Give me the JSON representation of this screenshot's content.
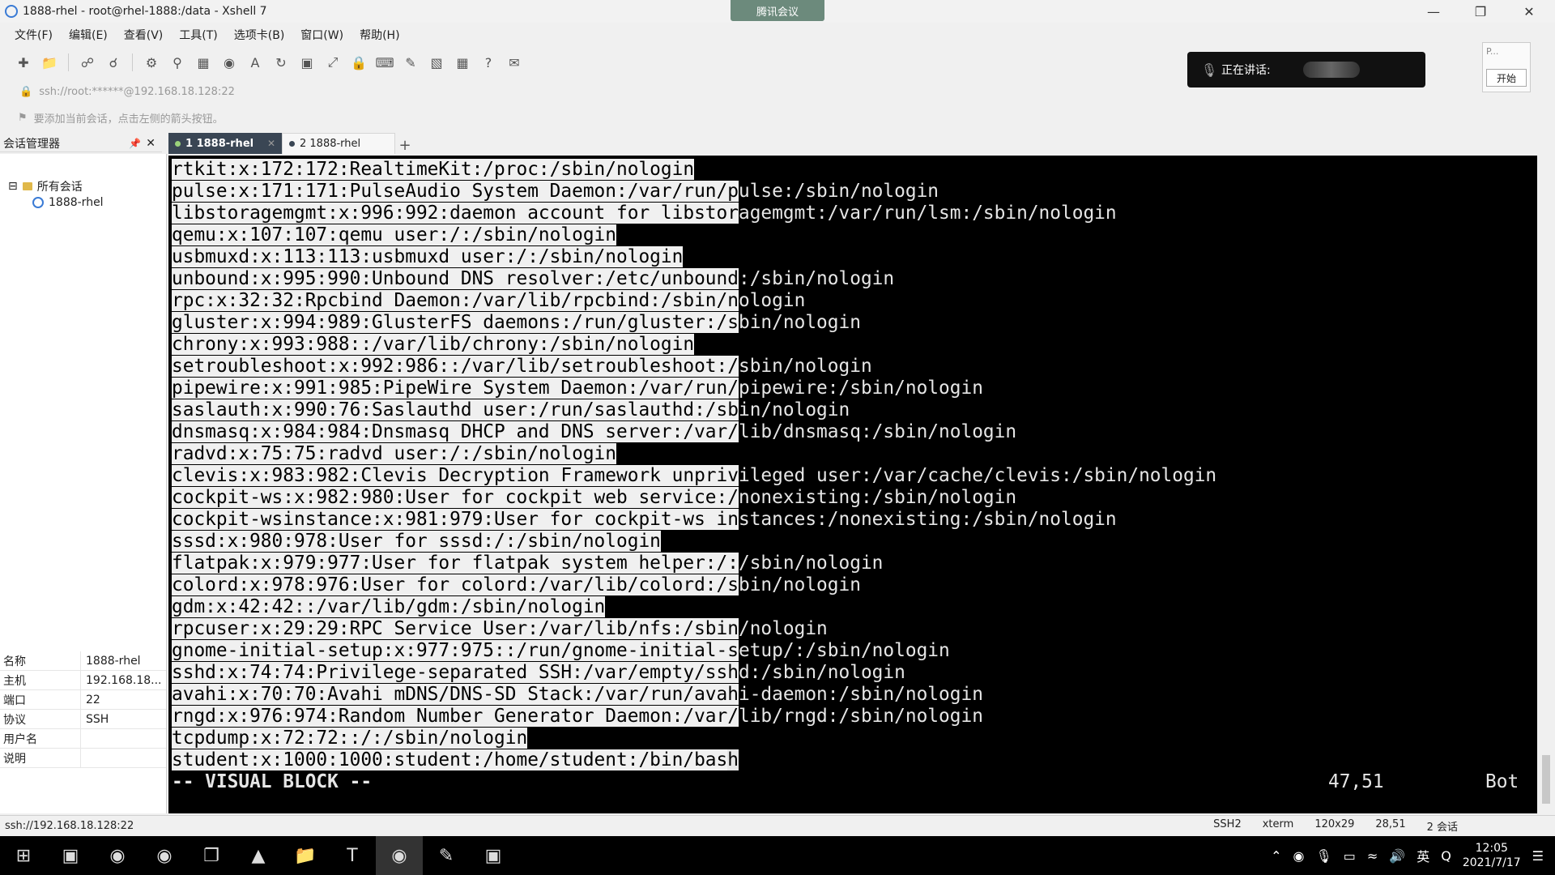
{
  "window": {
    "title": "1888-rhel - root@rhel-1888:/data - Xshell 7",
    "meeting_tab": "腾讯会议"
  },
  "menu": [
    "文件(F)",
    "编辑(E)",
    "查看(V)",
    "工具(T)",
    "选项卡(B)",
    "窗口(W)",
    "帮助(H)"
  ],
  "meeting": {
    "speaking_label": "正在讲话:",
    "panel_label": "P...",
    "start_button": "开始"
  },
  "address": "ssh://root:******@192.168.18.128:22",
  "hint": "要添加当前会话，点击左侧的箭头按钮。",
  "session_manager": {
    "title": "会话管理器",
    "root": "所有会话",
    "child": "1888-rhel"
  },
  "properties": [
    {
      "key": "名称",
      "value": "1888-rhel"
    },
    {
      "key": "主机",
      "value": "192.168.18..."
    },
    {
      "key": "端口",
      "value": "22"
    },
    {
      "key": "协议",
      "value": "SSH"
    },
    {
      "key": "用户名",
      "value": ""
    },
    {
      "key": "说明",
      "value": ""
    }
  ],
  "tabs": [
    {
      "label": "1 1888-rhel",
      "active": true
    },
    {
      "label": "2 1888-rhel",
      "active": false
    }
  ],
  "terminal": {
    "lines": [
      {
        "sel": "rtkit:x:172:172:RealtimeKit:/proc:/sbin/nologin",
        "rest": ""
      },
      {
        "sel": "pulse:x:171:171:PulseAudio System Daemon:/var/run/p",
        "rest": "ulse:/sbin/nologin"
      },
      {
        "sel": "libstoragemgmt:x:996:992:daemon account for libstor",
        "rest": "agemgmt:/var/run/lsm:/sbin/nologin"
      },
      {
        "sel": "qemu:x:107:107:qemu user:/:/sbin/nologin",
        "rest": ""
      },
      {
        "sel": "usbmuxd:x:113:113:usbmuxd user:/:/sbin/nologin",
        "rest": ""
      },
      {
        "sel": "unbound:x:995:990:Unbound DNS resolver:/etc/unbound",
        "rest": ":/sbin/nologin"
      },
      {
        "sel": "rpc:x:32:32:Rpcbind Daemon:/var/lib/rpcbind:/sbin/n",
        "rest": "ologin"
      },
      {
        "sel": "gluster:x:994:989:GlusterFS daemons:/run/gluster:/s",
        "rest": "bin/nologin"
      },
      {
        "sel": "chrony:x:993:988::/var/lib/chrony:/sbin/nologin",
        "rest": ""
      },
      {
        "sel": "setroubleshoot:x:992:986::/var/lib/setroubleshoot:/",
        "rest": "sbin/nologin"
      },
      {
        "sel": "pipewire:x:991:985:PipeWire System Daemon:/var/run/",
        "rest": "pipewire:/sbin/nologin"
      },
      {
        "sel": "saslauth:x:990:76:Saslauthd user:/run/saslauthd:/sb",
        "rest": "in/nologin"
      },
      {
        "sel": "dnsmasq:x:984:984:Dnsmasq DHCP and DNS server:/var/",
        "rest": "lib/dnsmasq:/sbin/nologin"
      },
      {
        "sel": "radvd:x:75:75:radvd user:/:/sbin/nologin",
        "rest": ""
      },
      {
        "sel": "clevis:x:983:982:Clevis Decryption Framework unpriv",
        "rest": "ileged user:/var/cache/clevis:/sbin/nologin"
      },
      {
        "sel": "cockpit-ws:x:982:980:User for cockpit web service:/",
        "rest": "nonexisting:/sbin/nologin"
      },
      {
        "sel": "cockpit-wsinstance:x:981:979:User for cockpit-ws in",
        "rest": "stances:/nonexisting:/sbin/nologin"
      },
      {
        "sel": "sssd:x:980:978:User for sssd:/:/sbin/nologin",
        "rest": ""
      },
      {
        "sel": "flatpak:x:979:977:User for flatpak system helper:/:",
        "rest": "/sbin/nologin"
      },
      {
        "sel": "colord:x:978:976:User for colord:/var/lib/colord:/s",
        "rest": "bin/nologin"
      },
      {
        "sel": "gdm:x:42:42::/var/lib/gdm:/sbin/nologin",
        "rest": ""
      },
      {
        "sel": "rpcuser:x:29:29:RPC Service User:/var/lib/nfs:/sbin",
        "rest": "/nologin"
      },
      {
        "sel": "gnome-initial-setup:x:977:975::/run/gnome-initial-s",
        "rest": "etup/:/sbin/nologin"
      },
      {
        "sel": "sshd:x:74:74:Privilege-separated SSH:/var/empty/ssh",
        "rest": "d:/sbin/nologin"
      },
      {
        "sel": "avahi:x:70:70:Avahi mDNS/DNS-SD Stack:/var/run/avah",
        "rest": "i-daemon:/sbin/nologin"
      },
      {
        "sel": "rngd:x:976:974:Random Number Generator Daemon:/var/",
        "rest": "lib/rngd:/sbin/nologin"
      },
      {
        "sel": "tcpdump:x:72:72::/:/sbin/nologin",
        "rest": ""
      },
      {
        "sel": "student:x:1000:1000:student:/home/student:/bin/bas",
        "rest": "h"
      }
    ],
    "mode": "-- VISUAL BLOCK --",
    "position": "47,51",
    "scroll": "Bot"
  },
  "statusbar": {
    "left": "ssh://192.168.18.128:22",
    "protocol": "SSH2",
    "term": "xterm",
    "size": "120x29",
    "cursor": "28,51",
    "sessions": "2 会话"
  },
  "tray": {
    "ime": "英",
    "time": "12:05",
    "date": "2021/7/17"
  }
}
